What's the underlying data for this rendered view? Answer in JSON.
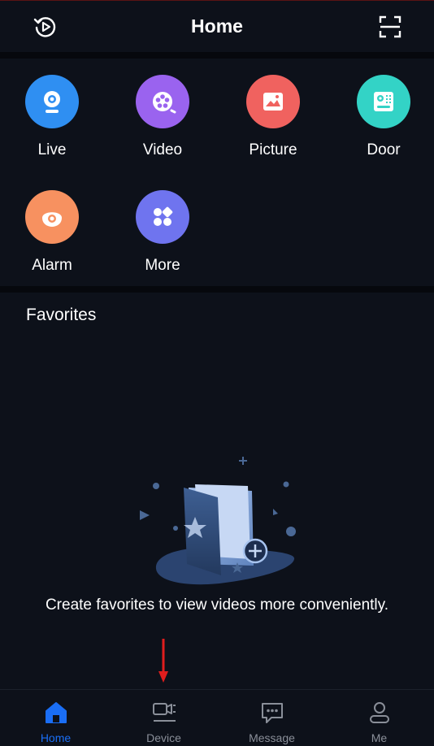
{
  "header": {
    "title": "Home"
  },
  "shortcuts": [
    {
      "label": "Live",
      "icon": "camera-icon",
      "color": "#2f8ff2"
    },
    {
      "label": "Video",
      "icon": "film-reel-icon",
      "color": "#9a63ef"
    },
    {
      "label": "Picture",
      "icon": "picture-icon",
      "color": "#f0625f"
    },
    {
      "label": "Door",
      "icon": "door-intercom-icon",
      "color": "#33d3c6"
    },
    {
      "label": "Alarm",
      "icon": "alarm-icon",
      "color": "#f79160"
    },
    {
      "label": "More",
      "icon": "grid-more-icon",
      "color": "#6f74ef"
    }
  ],
  "favorites": {
    "title": "Favorites",
    "empty_message": "Create favorites to view videos more conveniently."
  },
  "tabs": [
    {
      "label": "Home",
      "icon": "home-icon",
      "active": true
    },
    {
      "label": "Device",
      "icon": "device-icon",
      "active": false
    },
    {
      "label": "Message",
      "icon": "message-icon",
      "active": false
    },
    {
      "label": "Me",
      "icon": "person-icon",
      "active": false
    }
  ],
  "colors": {
    "background": "#0d111a",
    "accent": "#1a6ef5",
    "annotation_arrow": "#e01d1d"
  }
}
